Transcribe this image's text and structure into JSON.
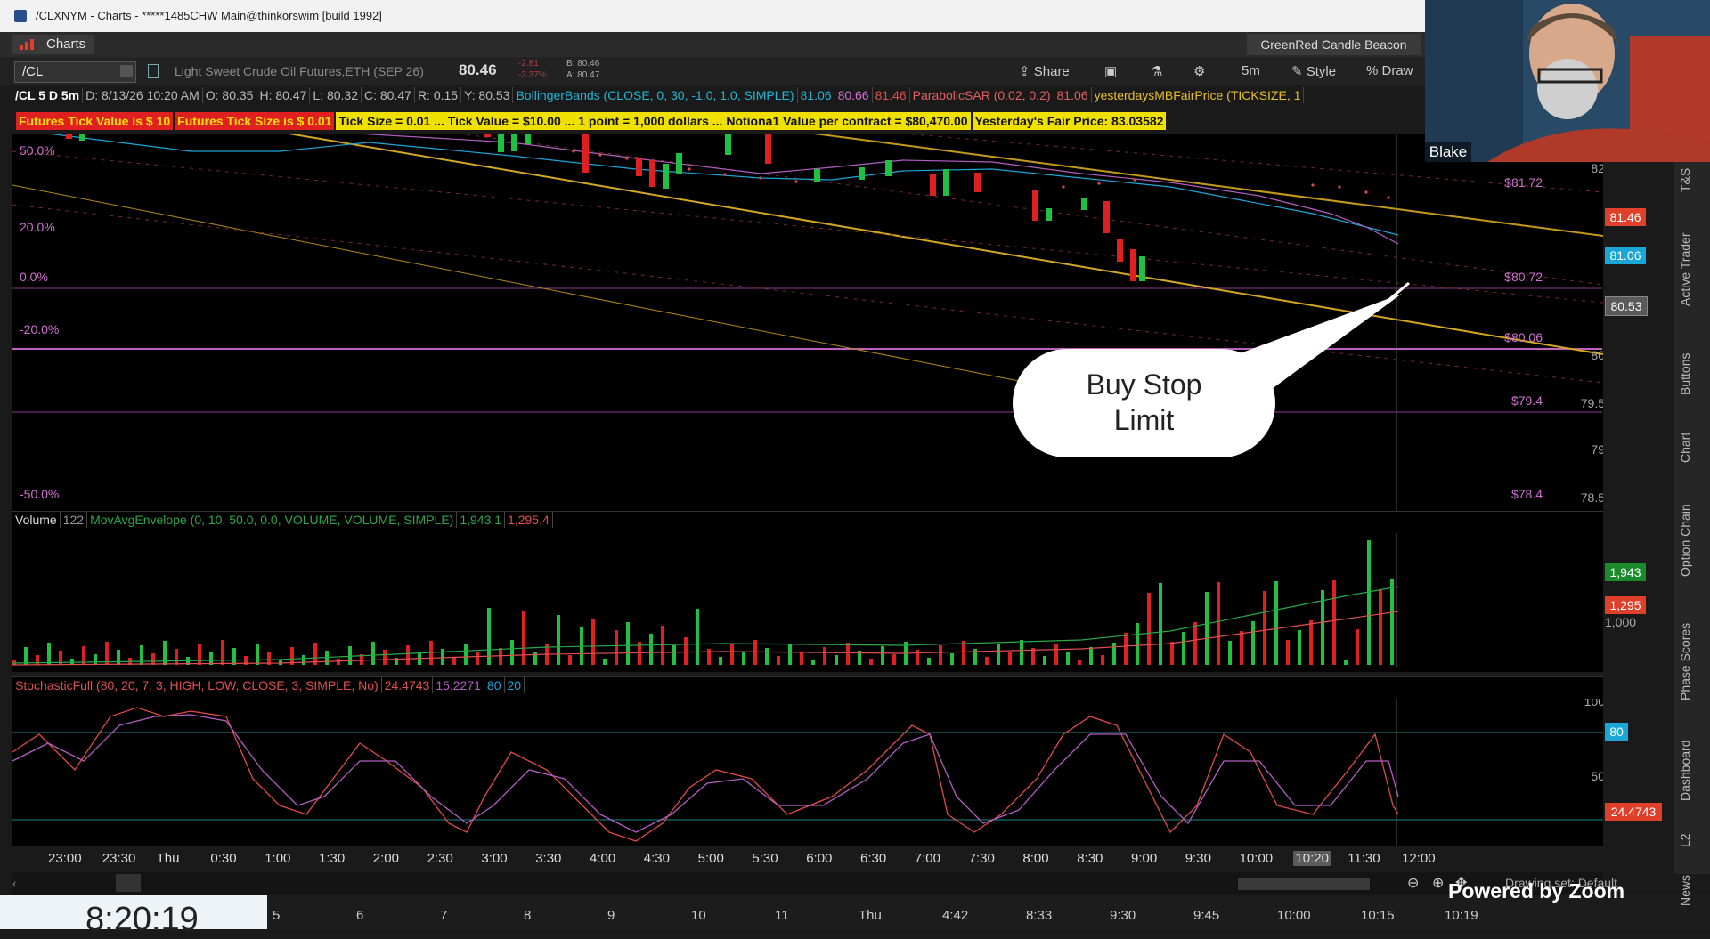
{
  "window": {
    "title": "/CLXNYM - Charts - *****1485CHW Main@thinkorswim [build 1992]"
  },
  "tabs": {
    "charts_label": "Charts",
    "study_label": "GreenRed Candle Beacon"
  },
  "toolbar": {
    "symbol": "/CL",
    "description": "Light Sweet Crude Oil Futures,ETH (SEP 26)",
    "last_price": "80.46",
    "change_abs": "-2.81",
    "change_pct": "-3.37%",
    "bid": "B: 80.46",
    "ask": "A: 80.47",
    "share_label": "Share",
    "timeframe_label": "5m",
    "style_label": "Style",
    "drawings_label": "Draw"
  },
  "info_row": {
    "period": "/CL 5 D 5m",
    "date": "D: 8/13/26 10:20 AM",
    "open": "O: 80.35",
    "high": "H: 80.47",
    "low": "L: 80.32",
    "close": "C: 80.47",
    "range": "R: 0.15",
    "y": "Y: 80.53",
    "bollinger": "BollingerBands (CLOSE, 0, 30, -1.0, 1.0, SIMPLE)",
    "bb_upper": "81.06",
    "bb_mid": "80.66",
    "bb_lower": "81.46",
    "sar": "ParabolicSAR (0.02, 0.2)",
    "sar_value": "81.06",
    "fair": "yesterdaysMBFairPrice (TICKSIZE, 1"
  },
  "labels_row": {
    "tick_value": "Futures Tick Value is $ 10",
    "tick_size": "Futures Tick Size is $ 0.01",
    "summary": "Tick Size = 0.01 ... Tick Value = $10.00 ... 1 point = 1,000 dollars ... Notiona1 Value per contract = $80,470.00",
    "fair_price": "Yesterday's Fair Price: 83.03582"
  },
  "fib_levels": {
    "p50": "50.0%",
    "p20": "20.0%",
    "p0": "0.0%",
    "m20": "-20.0%",
    "m50": "-50.0%",
    "v50": "$81.72",
    "v20": "$80.72",
    "v0": "$80.06",
    "vm20": "$79.4",
    "vm50": "$78.4"
  },
  "price_axis": {
    "ticks": [
      "82",
      "80",
      "79.5",
      "79",
      "78.5"
    ],
    "badge_red": "81.46",
    "badge_blue": "81.06",
    "badge_gray": "80.53",
    "badge_red_color": "#e0402a",
    "badge_blue_color": "#1aa6d6",
    "badge_gray_color": "#5a5a5a"
  },
  "annotation": {
    "line1": "Buy Stop",
    "line2": "Limit"
  },
  "volume_panel": {
    "label": "Volume",
    "value": "122",
    "study": "MovAvgEnvelope (0, 10, 50.0, 0.0, VOLUME, VOLUME, SIMPLE)",
    "upper": "1,943.1",
    "lower": "1,295.4",
    "axis_tick": "1,000",
    "badge_green": "1,943",
    "badge_red": "1,295"
  },
  "stoch_panel": {
    "study": "StochasticFull (80, 20, 7, 3, HIGH, LOW, CLOSE, 3, SIMPLE, No)",
    "k": "24.4743",
    "d": "15.2271",
    "ob": "80",
    "os": "20",
    "ticks": [
      "100",
      "50"
    ],
    "badge_80": "80",
    "badge_k": "24.4743"
  },
  "time_axis": [
    "23:00",
    "23:30",
    "Thu",
    "0:30",
    "1:00",
    "1:30",
    "2:00",
    "2:30",
    "3:00",
    "3:30",
    "4:00",
    "4:30",
    "5:00",
    "5:30",
    "6:00",
    "6:30",
    "7:00",
    "7:30",
    "8:00",
    "8:30",
    "9:00",
    "9:30",
    "10:00",
    "10:20",
    "11:30",
    "12:00"
  ],
  "drawing_set": "Drawing set: Default",
  "side_tabs": [
    "T&S",
    "Active Trader",
    "Buttons",
    "Chart",
    "Option Chain",
    "Phase Scores",
    "Dashboard",
    "L2",
    "News"
  ],
  "webcam": {
    "name": "Blake"
  },
  "bottom": {
    "clock": "8:20:19",
    "zoom": "Powered by Zoom",
    "mini_axis": [
      "5",
      "6",
      "7",
      "8",
      "9",
      "10",
      "11",
      "Thu",
      "4:42",
      "8:33",
      "9:30",
      "9:45",
      "10:00",
      "10:15",
      "10:19"
    ]
  }
}
